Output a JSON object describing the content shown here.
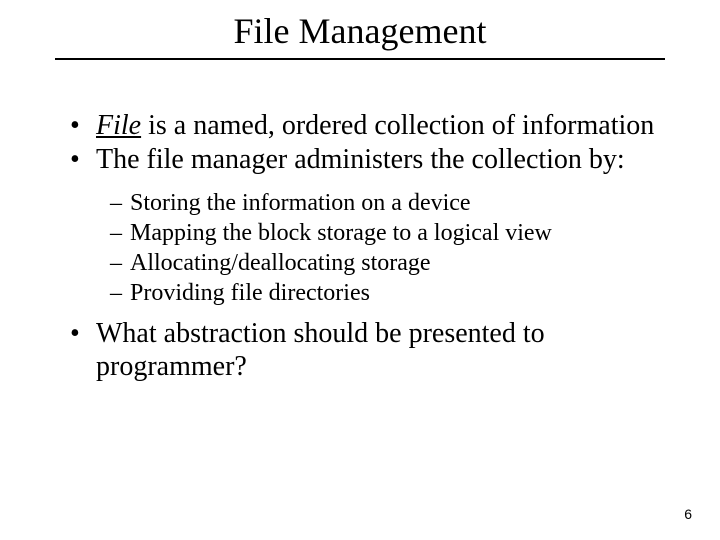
{
  "title": "File Management",
  "bullets": {
    "b1_word": "File",
    "b1_rest": " is a named, ordered collection of information",
    "b2": "The file manager administers the collection by:",
    "b3": "What abstraction should be presented to programmer?"
  },
  "sub": {
    "s1": "Storing the information on a device",
    "s2": "Mapping the block storage to a logical view",
    "s3": "Allocating/deallocating storage",
    "s4": "Providing file directories"
  },
  "page_number": "6"
}
